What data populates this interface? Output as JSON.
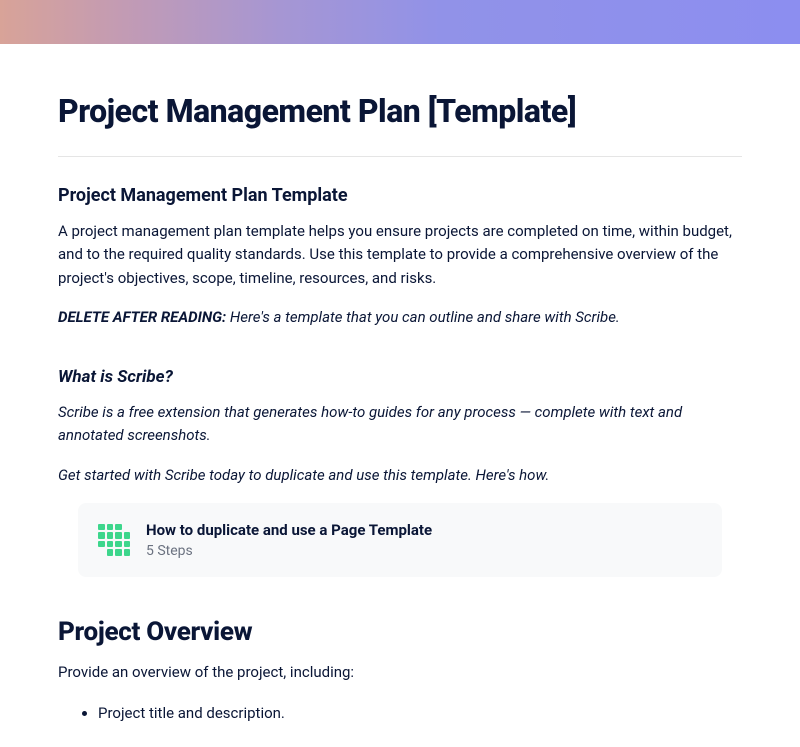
{
  "page_title": "Project Management Plan [Template]",
  "intro": {
    "heading": "Project Management Plan Template",
    "description": "A project management plan template helps you ensure projects are completed on time, within budget, and to the required quality standards. Use this template to provide a comprehensive overview of the project's objectives, scope, timeline, resources, and risks.",
    "delete_label": "DELETE AFTER READING:",
    "delete_text": " Here's a template that you can outline and share with Scribe."
  },
  "scribe": {
    "heading": "What is Scribe?",
    "description": "Scribe is a free extension that generates how-to guides for any process — complete with text and annotated screenshots.",
    "get_started": "Get started with Scribe today to duplicate and use this template. Here's how."
  },
  "card": {
    "title": "How to duplicate and use a Page Template",
    "subtitle": "5 Steps"
  },
  "overview": {
    "heading": "Project Overview",
    "intro": "Provide an overview of the project, including:",
    "items": [
      "Project title and description."
    ]
  }
}
